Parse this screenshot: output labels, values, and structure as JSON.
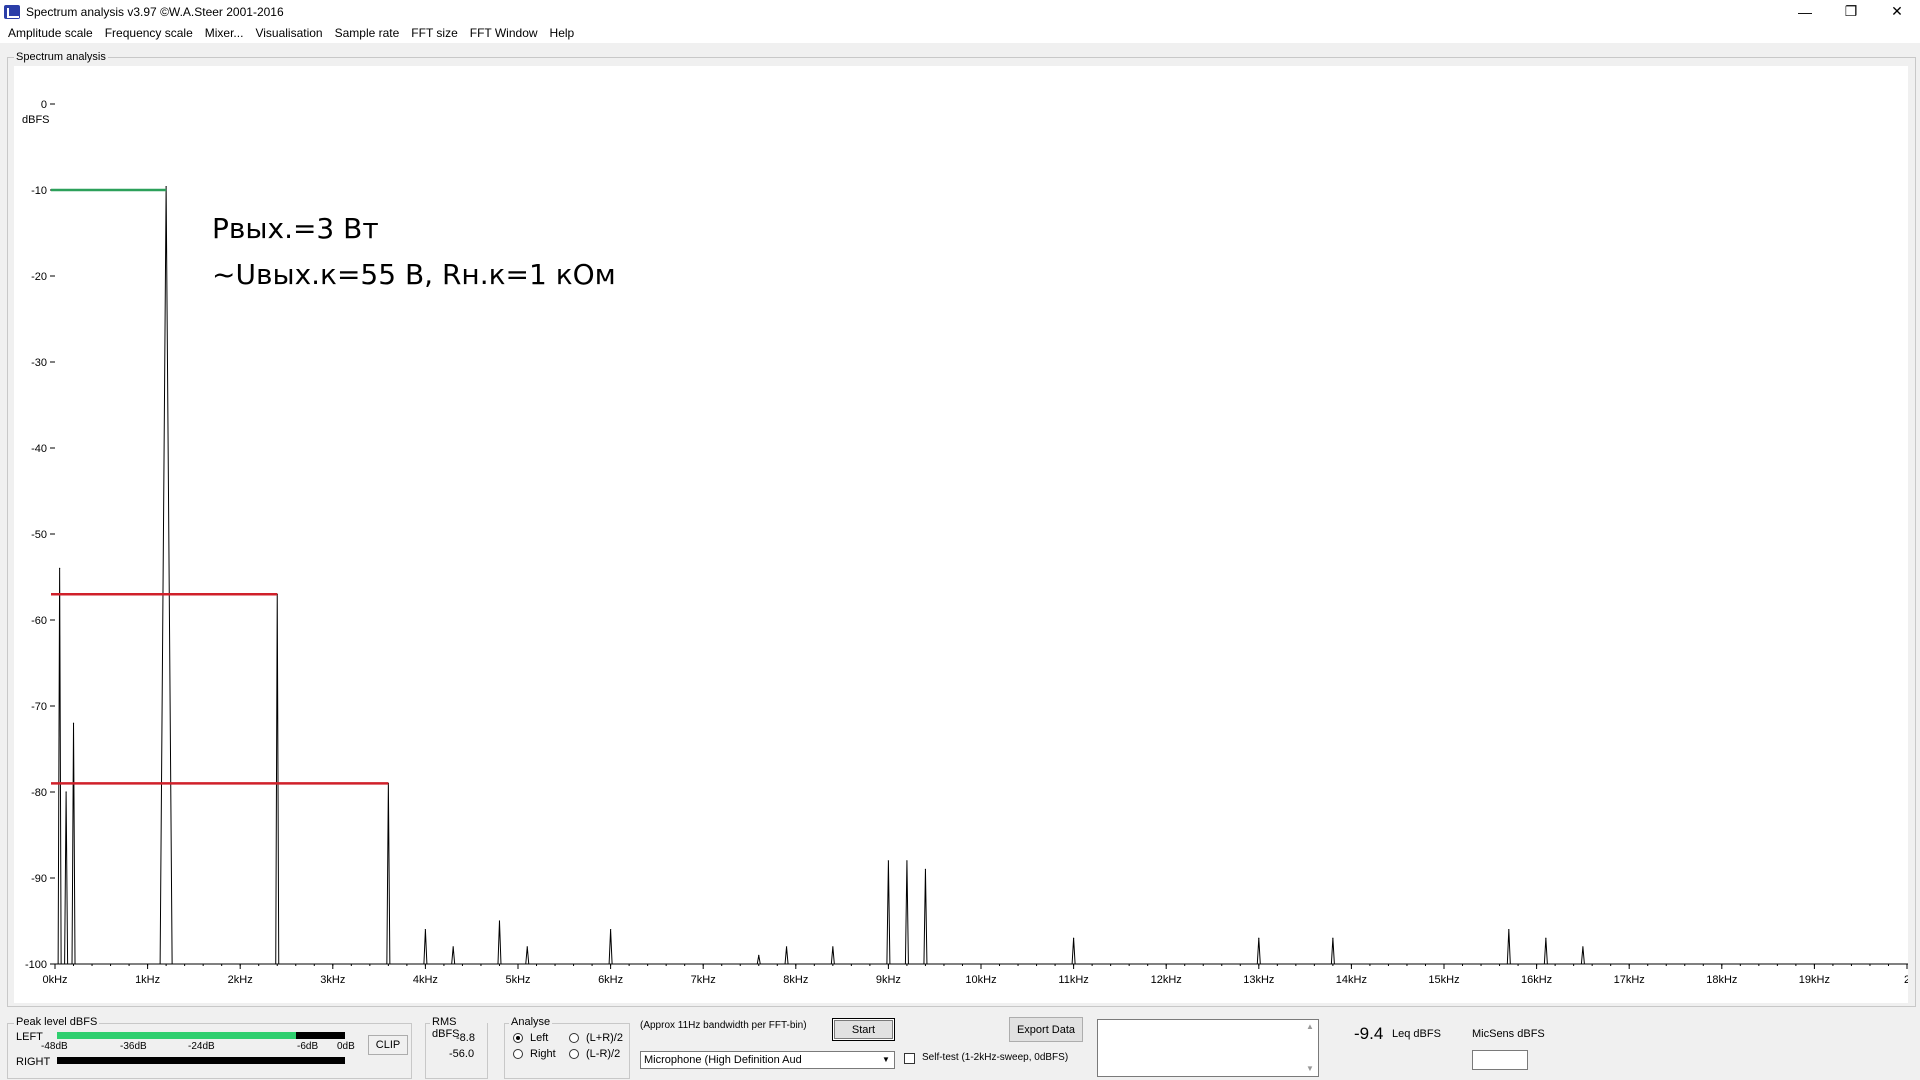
{
  "window": {
    "title": "Spectrum analysis v3.97  ©W.A.Steer 2001-2016",
    "minimize_glyph": "—",
    "maximize_glyph": "❐",
    "close_glyph": "✕"
  },
  "menu": [
    "Amplitude scale",
    "Frequency scale",
    "Mixer...",
    "Visualisation",
    "Sample rate",
    "FFT size",
    "FFT Window",
    "Help"
  ],
  "group_label": "Spectrum analysis",
  "annotation": {
    "line1": "Рвых.=3 Вт",
    "line2": "~Uвых.к=55 В, Rн.к=1 кОм"
  },
  "chart_data": {
    "type": "line",
    "title": "",
    "ylabel": "dBFS",
    "xlabel": "",
    "y_ticks": [
      "0",
      "-10",
      "-20",
      "-30",
      "-40",
      "-50",
      "-60",
      "-70",
      "-80",
      "-90",
      "-100"
    ],
    "x_ticks": [
      "0kHz",
      "1kHz",
      "2kHz",
      "3kHz",
      "4kHz",
      "5kHz",
      "6kHz",
      "7kHz",
      "8kHz",
      "9kHz",
      "10kHz",
      "11kHz",
      "12kHz",
      "13kHz",
      "14kHz",
      "15kHz",
      "16kHz",
      "17kHz",
      "18kHz",
      "19kHz",
      "2"
    ],
    "xlim_khz": [
      0,
      20
    ],
    "ylim": [
      -100,
      0
    ],
    "line_color": "#000000",
    "peaks": [
      {
        "f_khz": 0.05,
        "db": -54
      },
      {
        "f_khz": 0.12,
        "db": -80
      },
      {
        "f_khz": 0.2,
        "db": -72
      },
      {
        "f_khz": 1.2,
        "db": -9.6
      },
      {
        "f_khz": 2.4,
        "db": -57
      },
      {
        "f_khz": 3.6,
        "db": -79
      },
      {
        "f_khz": 4.0,
        "db": -96
      },
      {
        "f_khz": 4.3,
        "db": -98
      },
      {
        "f_khz": 4.8,
        "db": -95
      },
      {
        "f_khz": 5.1,
        "db": -98
      },
      {
        "f_khz": 6.0,
        "db": -96
      },
      {
        "f_khz": 7.6,
        "db": -99
      },
      {
        "f_khz": 7.9,
        "db": -98
      },
      {
        "f_khz": 8.4,
        "db": -98
      },
      {
        "f_khz": 9.0,
        "db": -88
      },
      {
        "f_khz": 9.2,
        "db": -88
      },
      {
        "f_khz": 9.4,
        "db": -89
      },
      {
        "f_khz": 11.0,
        "db": -97
      },
      {
        "f_khz": 13.0,
        "db": -97
      },
      {
        "f_khz": 13.8,
        "db": -97
      },
      {
        "f_khz": 15.7,
        "db": -96
      },
      {
        "f_khz": 16.1,
        "db": -97
      },
      {
        "f_khz": 16.5,
        "db": -98
      }
    ],
    "markers": [
      {
        "name": "fundamental-level",
        "color": "#2ca05a",
        "db": -10,
        "to_khz": 1.2
      },
      {
        "name": "2nd-harmonic-level",
        "color": "#d0202a",
        "db": -57,
        "to_khz": 2.4
      },
      {
        "name": "3rd-harmonic-level",
        "color": "#d0202a",
        "db": -79,
        "to_khz": 3.6
      }
    ]
  },
  "peak_level": {
    "label": "Peak level dBFS",
    "left_label": "LEFT",
    "right_label": "RIGHT",
    "scale": [
      "-48dB",
      "-36dB",
      "-24dB",
      "-6dB",
      "0dB"
    ],
    "left_fill_percent": 83,
    "fill_color": "#2fcf6f",
    "clip_label": "CLIP"
  },
  "rms": {
    "label": "RMS dBFS",
    "left": "-8.8",
    "right": "-56.0"
  },
  "analyse": {
    "label": "Analyse",
    "options": [
      "Left",
      "Right",
      "(L+R)/2",
      "(L-R)/2"
    ],
    "selected": "Left"
  },
  "bandwidth_note": "(Approx 11Hz bandwidth per FFT-bin)",
  "start_button": "Start",
  "input_device": "Microphone (High Definition Aud",
  "self_test": "Self-test  (1-2kHz-sweep, 0dBFS)",
  "export_button": "Export Data",
  "leq": {
    "value": "-9.4",
    "label": "Leq dBFS"
  },
  "micsens": {
    "label": "MicSens dBFS",
    "value": ""
  }
}
